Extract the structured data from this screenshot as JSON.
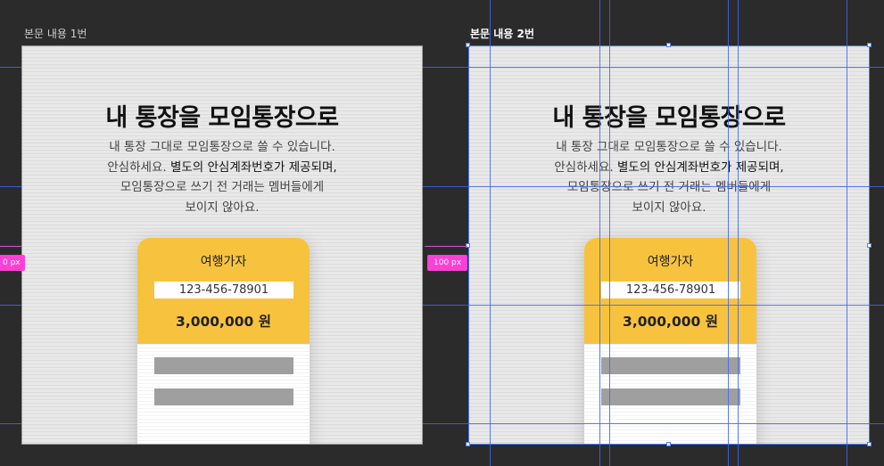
{
  "canvas": {
    "background": "#2b2b2b",
    "accent_selection": "#4a7cff",
    "measure_color": "#ff3fd6"
  },
  "frames": [
    {
      "label": "본문 내용 1번",
      "selected": false,
      "headline": "내 통장을 모임통장으로",
      "desc_line1": "내 통장 그대로 모임통장으로 쓸 수 있습니다.",
      "desc_line2_a": "안심하세요. ",
      "desc_line2_b": "별도의 안심계좌번호가 제공되며,",
      "desc_line3": "모임통장으로 쓰기 전 거래는 멤버들에게",
      "desc_line4": "보이지 않아요.",
      "card": {
        "name": "여행가자",
        "account": "123-456-78901",
        "amount": "3,000,000 원",
        "color": "#f7c33f"
      }
    },
    {
      "label": "본문 내용 2번",
      "selected": true,
      "headline": "내 통장을 모임통장으로",
      "desc_line1": "내 통장 그대로 모임통장으로 쓸 수 있습니다.",
      "desc_line2_a": "안심하세요. ",
      "desc_line2_b": "별도의 안심계좌번호가 제공되며,",
      "desc_line3": "모임통장으로 쓰기 전 거래는 멤버들에게",
      "desc_line4": "보이지 않아요.",
      "card": {
        "name": "여행가자",
        "account": "123-456-78901",
        "amount": "3,000,000 원",
        "color": "#f7c33f"
      }
    }
  ],
  "measure": {
    "left_badge": "0 px",
    "right_badge": "100 px"
  }
}
